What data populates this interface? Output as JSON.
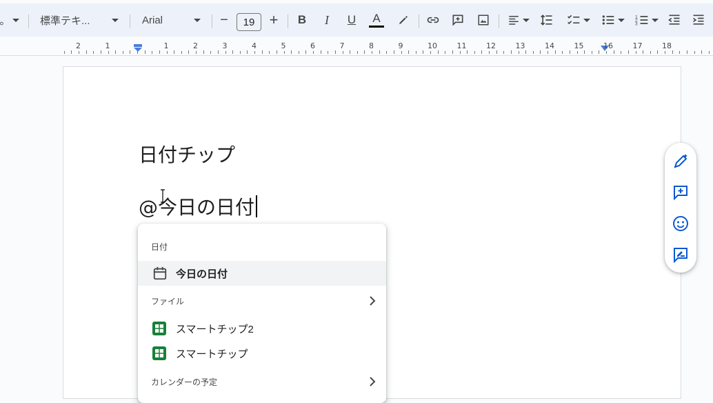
{
  "toolbar": {
    "style_label": "標準テキ...",
    "font_label": "Arial",
    "font_size": "19",
    "minus": "−",
    "plus": "+",
    "bold": "B",
    "italic": "I",
    "underline": "U",
    "text_color": "A",
    "left_clipped": "。"
  },
  "ruler": {
    "numbers": [
      "2",
      "1",
      "1",
      "2",
      "3",
      "4",
      "5",
      "6",
      "7",
      "8",
      "9",
      "10",
      "11",
      "12",
      "13",
      "14",
      "15",
      "16",
      "17",
      "18"
    ]
  },
  "document": {
    "heading": "日付チップ",
    "typed_text": "@今日の日付"
  },
  "popup": {
    "section_date": "日付",
    "today_item": "今日の日付",
    "section_files": "ファイル",
    "file_items": [
      "スマートチップ2",
      "スマートチップ"
    ],
    "section_calendar": "カレンダーの予定"
  },
  "colors": {
    "accent": "#0b57d0",
    "sheets_green": "#188038",
    "toolbar_bg": "#edf2fa"
  }
}
